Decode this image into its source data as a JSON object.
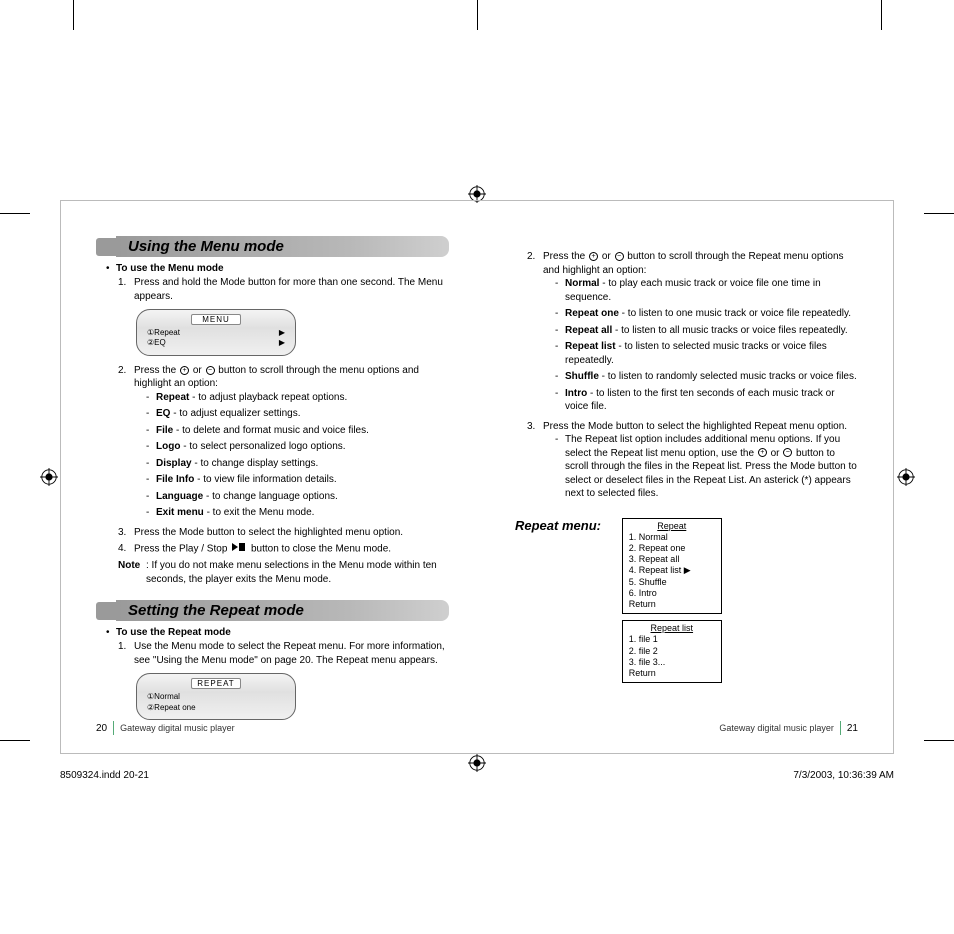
{
  "sections": {
    "menu_mode": {
      "title": "Using the Menu mode",
      "lead": "To use the Menu mode",
      "step1": "Press and hold the Mode button for more than one second. The Menu appears.",
      "lcd": {
        "title": "MENU",
        "row1_left": "①Repeat",
        "row2_left": "②EQ"
      },
      "step2_pre": "Press the",
      "step2_mid": "or",
      "step2_post": "button to scroll through the menu options and highlight an option:",
      "options": [
        {
          "name": "Repeat",
          "desc": " - to adjust playback repeat options."
        },
        {
          "name": "EQ",
          "desc": " - to adjust equalizer settings."
        },
        {
          "name": "File",
          "desc": " - to delete and format music and voice files."
        },
        {
          "name": "Logo",
          "desc": " - to select personalized logo options."
        },
        {
          "name": "Display",
          "desc": " - to change display settings."
        },
        {
          "name": "File Info",
          "desc": " - to view file information details."
        },
        {
          "name": "Language",
          "desc": " - to change language options."
        },
        {
          "name": "Exit menu",
          "desc": " - to exit the Menu mode."
        }
      ],
      "step3": "Press the Mode button to select the highlighted menu option.",
      "step4_pre": "Press the Play / Stop",
      "step4_post": "button to close the Menu mode.",
      "note_label": "Note",
      "note_text": ": If you do not make menu selections in the Menu mode within ten seconds, the player exits the Menu mode."
    },
    "repeat_mode": {
      "title": "Setting the Repeat mode",
      "lead": "To use the Repeat mode",
      "step1": "Use the Menu mode to select the Repeat menu. For more information, see \"Using the Menu mode\" on page 20. The Repeat menu appears.",
      "lcd": {
        "title": "REPEAT",
        "row1_left": "①Normal",
        "row2_left": "②Repeat one"
      },
      "step2_pre": "Press the",
      "step2_mid": "or",
      "step2_post": "button to scroll through the Repeat menu options and highlight an option:",
      "options": [
        {
          "name": "Normal",
          "desc": " - to play each music track or voice file one time in sequence."
        },
        {
          "name": "Repeat one",
          "desc": " - to listen to one music track or voice file repeatedly."
        },
        {
          "name": "Repeat all",
          "desc": " - to listen to all music tracks or voice files repeatedly."
        },
        {
          "name": "Repeat list",
          "desc": " - to listen to selected music tracks or voice files repeatedly."
        },
        {
          "name": "Shuffle",
          "desc": " - to listen to randomly selected music tracks or voice files."
        },
        {
          "name": "Intro",
          "desc": " - to listen to the first ten seconds of each music track or voice file."
        }
      ],
      "step3": "Press the Mode button to select the highlighted Repeat menu option.",
      "step3_sub_pre": "The Repeat list option includes additional menu options. If you select the Repeat list menu option, use the",
      "step3_sub_mid": "or",
      "step3_sub_post": "button to scroll through the files in the Repeat list. Press the Mode button to select or deselect files in the Repeat List. An asterick (*) appears next to selected files."
    },
    "repeat_menu": {
      "heading": "Repeat menu:",
      "box1": {
        "title": "Repeat",
        "lines": [
          "1. Normal",
          "2. Repeat one",
          "3. Repeat all",
          "4. Repeat list  ▶",
          "5. Shuffle",
          "6. Intro",
          "    Return"
        ]
      },
      "box2": {
        "title": "Repeat list",
        "lines": [
          "1. file 1",
          "2. file 2",
          "3. file 3...",
          "    Return"
        ]
      }
    }
  },
  "footer": {
    "product": "Gateway digital music player",
    "page_left": "20",
    "page_right": "21"
  },
  "imprint": {
    "file": "8509324.indd   20-21",
    "timestamp": "7/3/2003, 10:36:39 AM"
  }
}
